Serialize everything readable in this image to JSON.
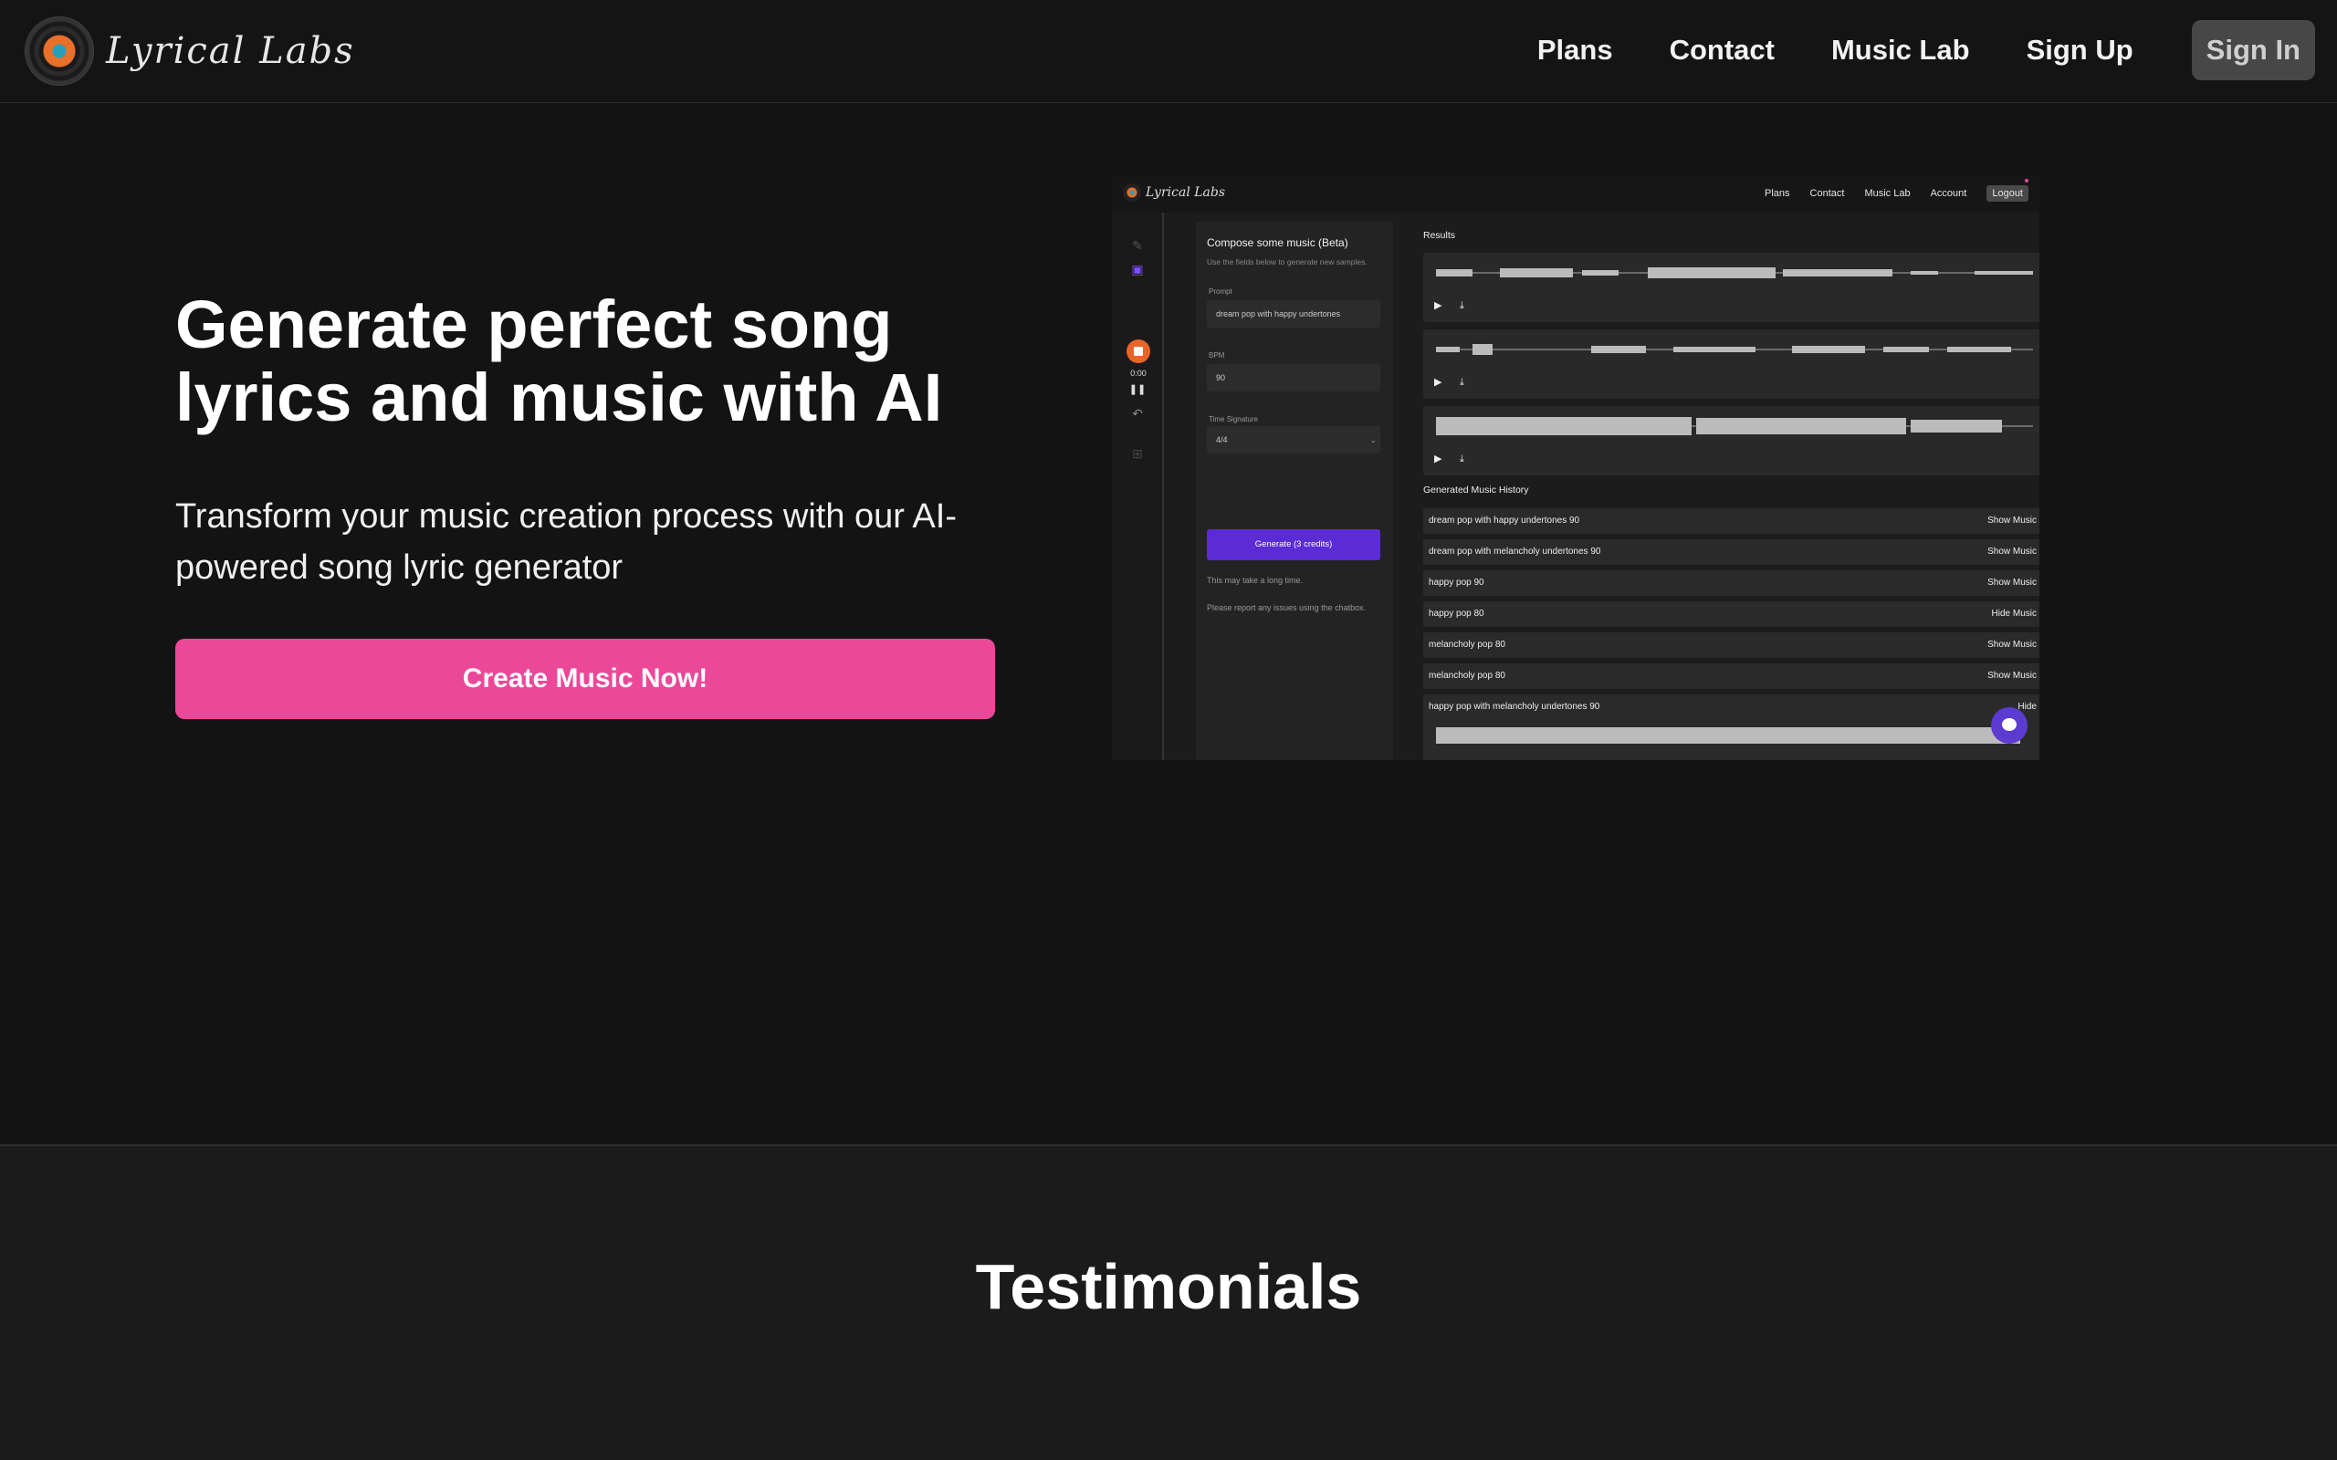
{
  "nav": {
    "logo_text": "Lyrical Labs",
    "links": [
      "Plans",
      "Contact",
      "Music Lab",
      "Sign Up"
    ],
    "signin": "Sign In"
  },
  "hero": {
    "title": "Generate perfect song lyrics and music with AI",
    "subtitle": "Transform your music creation process with our AI-powered song lyric generator",
    "cta": "Create Music Now!"
  },
  "preview": {
    "logo_text": "Lyrical Labs",
    "nav_links": [
      "Plans",
      "Contact",
      "Music Lab",
      "Account"
    ],
    "logout": "Logout",
    "timer": "0:00",
    "form": {
      "title": "Compose some music (Beta)",
      "description": "Use the fields below to generate new samples.",
      "prompt_label": "Prompt",
      "prompt_value": "dream pop with happy undertones",
      "bpm_label": "BPM",
      "bpm_value": "90",
      "time_sig_label": "Time Signature",
      "time_sig_value": "4/4",
      "generate_button": "Generate (3 credits)",
      "note1": "This may take a long time.",
      "note2": "Please report any issues using the chatbox."
    },
    "results_title": "Results",
    "history_title": "Generated Music History",
    "history": [
      {
        "name": "dream pop with happy undertones 90",
        "action": "Show Music"
      },
      {
        "name": "dream pop with melancholy undertones 90",
        "action": "Show Music"
      },
      {
        "name": "happy pop 90",
        "action": "Show Music"
      },
      {
        "name": "happy pop 80",
        "action": "Hide Music"
      },
      {
        "name": "melancholy pop 80",
        "action": "Show Music"
      },
      {
        "name": "melancholy pop 80",
        "action": "Show Music"
      },
      {
        "name": "happy pop with melancholy undertones 90",
        "action": "Hide"
      }
    ]
  },
  "testimonials": {
    "title": "Testimonials"
  },
  "colors": {
    "accent_pink": "#ec4899",
    "accent_purple": "#5b2bd6",
    "record_orange": "#e8652a"
  }
}
